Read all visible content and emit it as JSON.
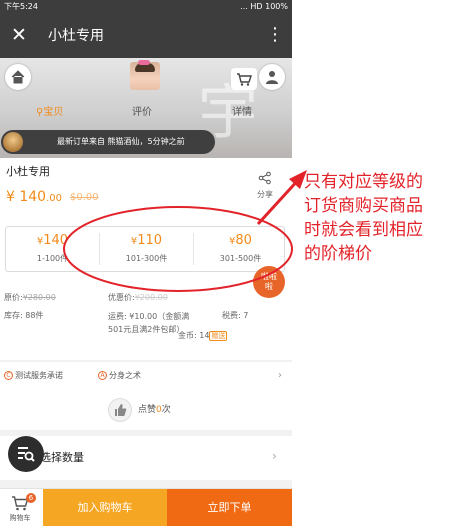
{
  "status_bar": {
    "time": "下午5:24",
    "right": "... HD 100%"
  },
  "title_bar": {
    "close_glyph": "✕",
    "title": "小杜专用",
    "more_glyph": "⋮"
  },
  "hero": {
    "watermark": "宇",
    "icons": [
      "home-icon",
      "cart-icon",
      "user-icon"
    ],
    "tabs": [
      {
        "label": "宝贝",
        "active": true
      },
      {
        "label": "评价",
        "active": false
      },
      {
        "label": "详情",
        "active": false
      }
    ],
    "order_banner": "最新订单来自 熊猫酒仙，5分钟之前"
  },
  "product": {
    "name": "小杜专用",
    "price_main": "¥ 140",
    "price_cents": ".00",
    "old_price": "$0.00",
    "share_label": "分享"
  },
  "tiers": [
    {
      "price": "140",
      "range": "1-100件"
    },
    {
      "price": "110",
      "range": "101-300件"
    },
    {
      "price": "80",
      "range": "301-500件"
    }
  ],
  "badge": {
    "line1": "啦啦",
    "line2": "啦"
  },
  "details": {
    "original_label": "原价:",
    "original_value": "¥280.00",
    "promo_label": "优惠价:",
    "promo_value": "¥200.00",
    "stock": "库存: 88件",
    "shipping": "运费: ¥10.00（金额满501元且满2件包邮）",
    "tax": "税费: 7",
    "coins_label": "金币: 14",
    "coins_tag": "赠送"
  },
  "services": {
    "item1": "测试服务承诺",
    "item2": "分身之术",
    "chevron": "›"
  },
  "likes": {
    "label": "点赞",
    "count": "0",
    "suffix": "次"
  },
  "quantity": {
    "label": "选择数量",
    "chevron": "›"
  },
  "bottom_bar": {
    "cart_label": "购物车",
    "cart_count": "6",
    "add_to_cart": "加入购物车",
    "buy_now": "立即下单"
  },
  "annotation": {
    "lines": [
      "只有对应等级的",
      "订货商购买商品",
      "时就会看到相应",
      "的阶梯价"
    ],
    "color": "#e2232a"
  },
  "colors": {
    "accent": "#f28b1a",
    "dark_bar": "#3d3d3d",
    "buy": "#f06a14",
    "add": "#f5a623"
  }
}
